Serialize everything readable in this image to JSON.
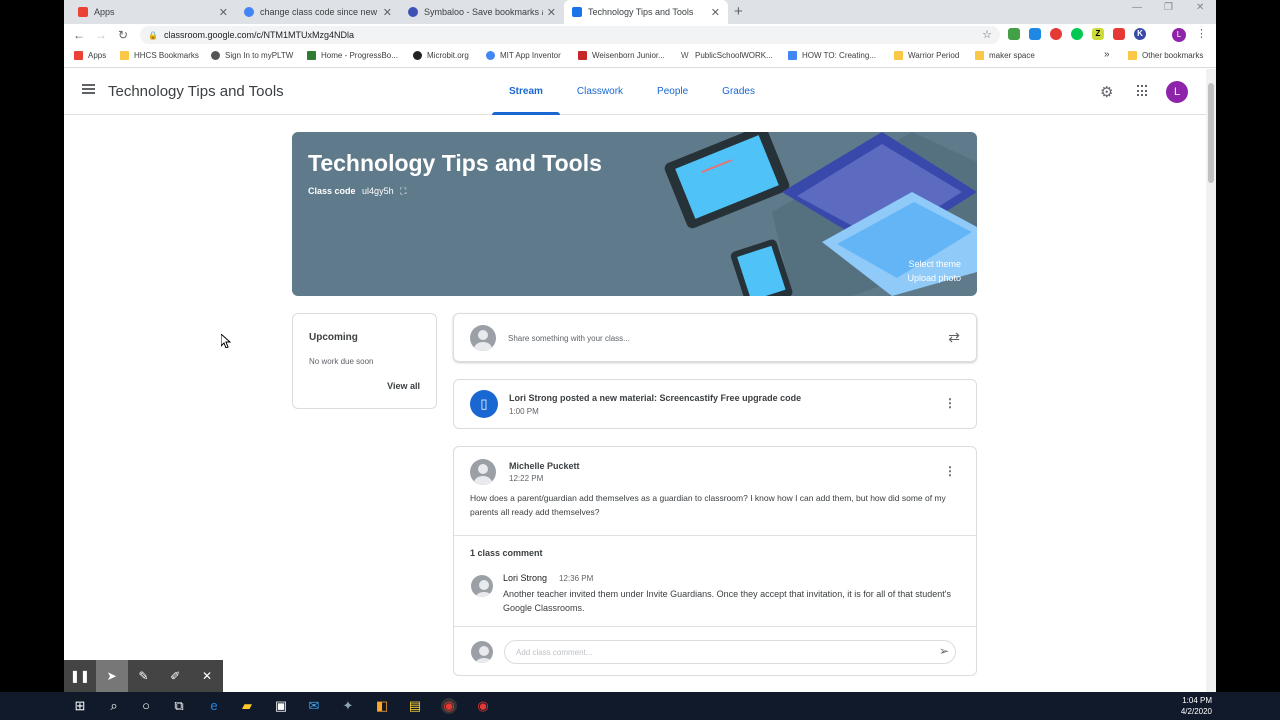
{
  "browser": {
    "tabs": [
      {
        "title": "Apps",
        "icon": "apps-icon",
        "color": "#ea4335"
      },
      {
        "title": "change class code since new goo",
        "icon": "google-icon",
        "color": "#4285f4"
      },
      {
        "title": "Symbaloo - Save bookmarks and",
        "icon": "symbaloo-icon",
        "color": "#3f51b5"
      },
      {
        "title": "Technology Tips and Tools",
        "icon": "classroom-icon",
        "color": "#1a73e8"
      }
    ],
    "url": "classroom.google.com/c/NTM1MTUxMzg4NDla",
    "profile_initial": "L",
    "bookmarks": [
      {
        "label": "Apps"
      },
      {
        "label": "HHCS Bookmarks"
      },
      {
        "label": "Sign In to myPLTW"
      },
      {
        "label": "Home - ProgressBo..."
      },
      {
        "label": "Microbit.org"
      },
      {
        "label": "MIT App Inventor"
      },
      {
        "label": "Weisenborn Junior..."
      },
      {
        "label": "PublicSchoolWORK..."
      },
      {
        "label": "HOW TO: Creating..."
      },
      {
        "label": "Warrior Period"
      },
      {
        "label": "maker space"
      },
      {
        "label": "»"
      },
      {
        "label": "Other bookmarks"
      }
    ]
  },
  "classroom": {
    "title": "Technology Tips and Tools",
    "tabs": [
      {
        "label": "Stream"
      },
      {
        "label": "Classwork"
      },
      {
        "label": "People"
      },
      {
        "label": "Grades"
      }
    ],
    "avatar_initial": "L",
    "banner": {
      "title": "Technology Tips and Tools",
      "class_code_label": "Class code",
      "class_code": "ul4gy5h",
      "select_theme": "Select theme",
      "upload_photo": "Upload photo"
    },
    "upcoming": {
      "title": "Upcoming",
      "subtitle": "No work due soon",
      "view_all": "View all"
    },
    "share_placeholder": "Share something with your class...",
    "material": {
      "text": "Lori Strong posted a new material: Screencastify Free upgrade code",
      "time": "1:00 PM"
    },
    "post": {
      "author": "Michelle Puckett",
      "time": "12:22 PM",
      "body": "How does a parent/guardian add themselves as a guardian to classroom? I know how I can add them, but how did some of my parents all ready add themselves?",
      "comment_count": "1 class comment",
      "comment": {
        "author": "Lori Strong",
        "time": "12:36 PM",
        "text": "Another teacher invited them under Invite Guardians. Once they accept that invitation, it is for all of that student's Google Classrooms."
      },
      "add_comment_placeholder": "Add class comment..."
    }
  },
  "taskbar": {
    "time": "1:04 PM",
    "date": "4/2/2020"
  }
}
